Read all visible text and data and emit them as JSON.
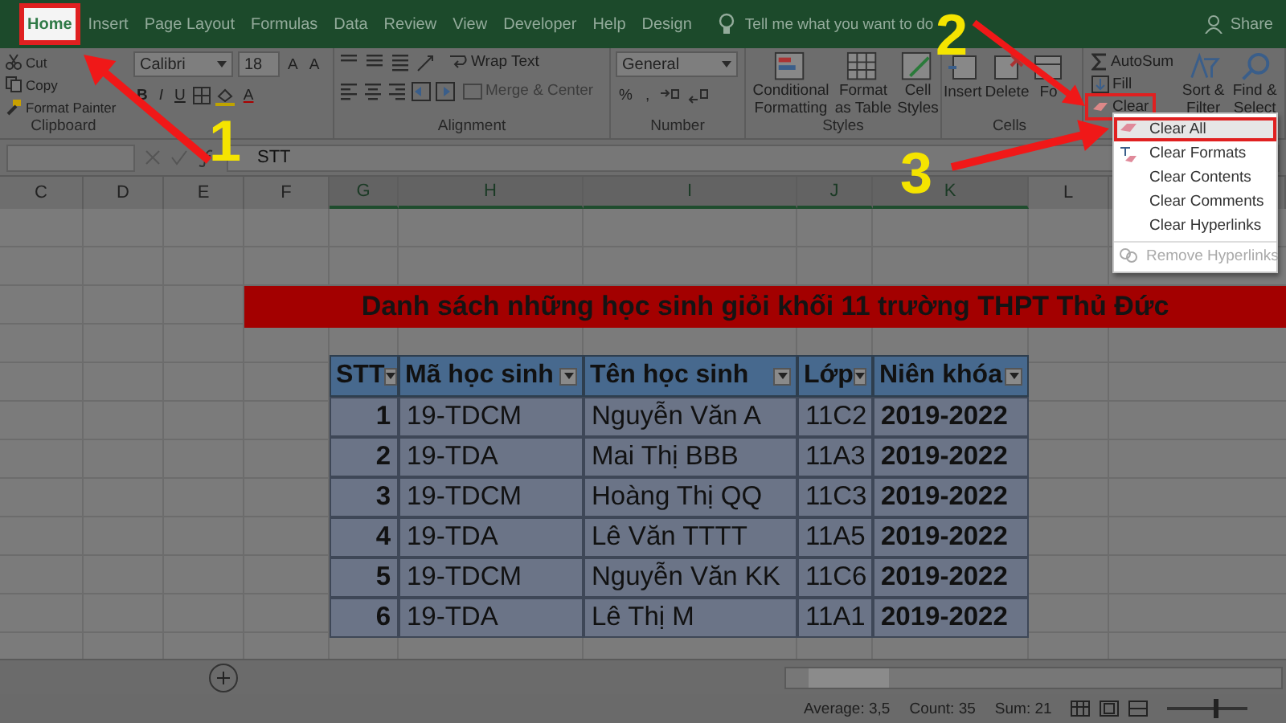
{
  "ribbon_tabs": [
    {
      "label": "Home",
      "selected": true
    },
    {
      "label": "Insert",
      "selected": false
    },
    {
      "label": "Page Layout",
      "selected": false
    },
    {
      "label": "Formulas",
      "selected": false
    },
    {
      "label": "Data",
      "selected": false
    },
    {
      "label": "Review",
      "selected": false
    },
    {
      "label": "View",
      "selected": false
    },
    {
      "label": "Developer",
      "selected": false
    },
    {
      "label": "Help",
      "selected": false
    },
    {
      "label": "Design",
      "selected": false
    }
  ],
  "tell_me": "Tell me what you want to do",
  "share": "Share",
  "clipboard": {
    "label": "Clipboard",
    "items": [
      "Cut",
      "Copy",
      "Format Painter"
    ]
  },
  "font": {
    "name": "Calibri",
    "size": "18",
    "grow": "A",
    "shrink": "A",
    "bold": "B",
    "italic": "I",
    "underline": "U",
    "tint_letter": "A"
  },
  "alignment": {
    "label": "Alignment",
    "wrap": "Wrap Text",
    "merge": "Merge & Center",
    "merge_disabled": true
  },
  "number": {
    "label": "Number",
    "format": "General",
    "percent": "%",
    "comma": ","
  },
  "styles": {
    "label": "Styles",
    "items": [
      "Conditional Formatting",
      "Format as Table",
      "Cell Styles"
    ]
  },
  "cells": {
    "label": "Cells",
    "items": [
      "Insert",
      "Delete",
      "Fo"
    ]
  },
  "editing": {
    "autosum": "AutoSum",
    "fill": "Fill",
    "clear": "Clear",
    "sort": "Sort & Filter",
    "find": "Find & Select"
  },
  "formula_bar": {
    "value": "STT"
  },
  "columns": [
    {
      "label": "C",
      "selected": false
    },
    {
      "label": "D",
      "selected": false
    },
    {
      "label": "E",
      "selected": false
    },
    {
      "label": "F",
      "selected": false
    },
    {
      "label": "G",
      "selected": true
    },
    {
      "label": "H",
      "selected": true
    },
    {
      "label": "I",
      "selected": true
    },
    {
      "label": "J",
      "selected": true
    },
    {
      "label": "K",
      "selected": true
    },
    {
      "label": "L",
      "selected": false
    }
  ],
  "sheet_title": "Danh sách những học sinh giỏi khối 11 trường THPT Thủ Đức",
  "table": {
    "columns": [
      "STT",
      "Mã học sinh",
      "Tên học sinh",
      "Lớp",
      "Niên khóa"
    ],
    "rows": [
      [
        "1",
        "19-TDCM",
        "Nguyễn Văn A",
        "11C2",
        "2019-2022"
      ],
      [
        "2",
        "19-TDA",
        "Mai Thị BBB",
        "11A3",
        "2019-2022"
      ],
      [
        "3",
        "19-TDCM",
        "Hoàng Thị QQ",
        "11C3",
        "2019-2022"
      ],
      [
        "4",
        "19-TDA",
        "Lê Văn TTTT",
        "11A5",
        "2019-2022"
      ],
      [
        "5",
        "19-TDCM",
        "Nguyễn Văn KK",
        "11C6",
        "2019-2022"
      ],
      [
        "6",
        "19-TDA",
        "Lê Thị M",
        "11A1",
        "2019-2022"
      ]
    ]
  },
  "clear_menu": [
    {
      "label": "Clear All",
      "selected": true,
      "disabled": false
    },
    {
      "label": "Clear Formats",
      "selected": false,
      "disabled": false
    },
    {
      "label": "Clear Contents",
      "selected": false,
      "disabled": false
    },
    {
      "label": "Clear Comments",
      "selected": false,
      "disabled": false
    },
    {
      "label": "Clear Hyperlinks",
      "selected": false,
      "disabled": false
    },
    {
      "label": "Remove Hyperlinks",
      "selected": false,
      "disabled": true
    }
  ],
  "status_bar": {
    "items": [
      "Average: 3,5",
      "Count: 35",
      "Sum: 21"
    ],
    "zoom": {
      "level": 0.6
    }
  },
  "annotations": [
    "1",
    "2",
    "3"
  ]
}
